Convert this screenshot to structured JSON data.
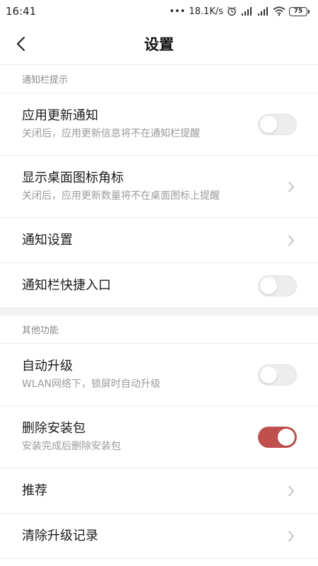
{
  "status_bar": {
    "time": "16:41",
    "dots": "•••",
    "speed": "18.1K/s",
    "battery": "75"
  },
  "header": {
    "title": "设置"
  },
  "sections": [
    {
      "header": "通知栏提示",
      "rows": [
        {
          "title": "应用更新通知",
          "subtitle": "关闭后，应用更新信息将不在通知栏提醒",
          "control": "toggle",
          "on": false
        },
        {
          "title": "显示桌面图标角标",
          "subtitle": "关闭后，应用更新数量将不在桌面图标上提醒",
          "control": "chevron"
        },
        {
          "title": "通知设置",
          "control": "chevron"
        },
        {
          "title": "通知栏快捷入口",
          "control": "toggle",
          "on": false
        }
      ]
    },
    {
      "header": "其他功能",
      "rows": [
        {
          "title": "自动升级",
          "subtitle": "WLAN网络下，锁屏时自动升级",
          "control": "toggle",
          "on": false
        },
        {
          "title": "删除安装包",
          "subtitle": "安装完成后删除安装包",
          "control": "toggle",
          "on": true
        },
        {
          "title": "推荐",
          "control": "chevron"
        },
        {
          "title": "清除升级记录",
          "control": "chevron"
        }
      ]
    }
  ],
  "colors": {
    "toggle_on": "#c0504d",
    "toggle_off": "#ededed",
    "section_text": "#8a8a8a",
    "subtitle_text": "#9a9a9a"
  }
}
